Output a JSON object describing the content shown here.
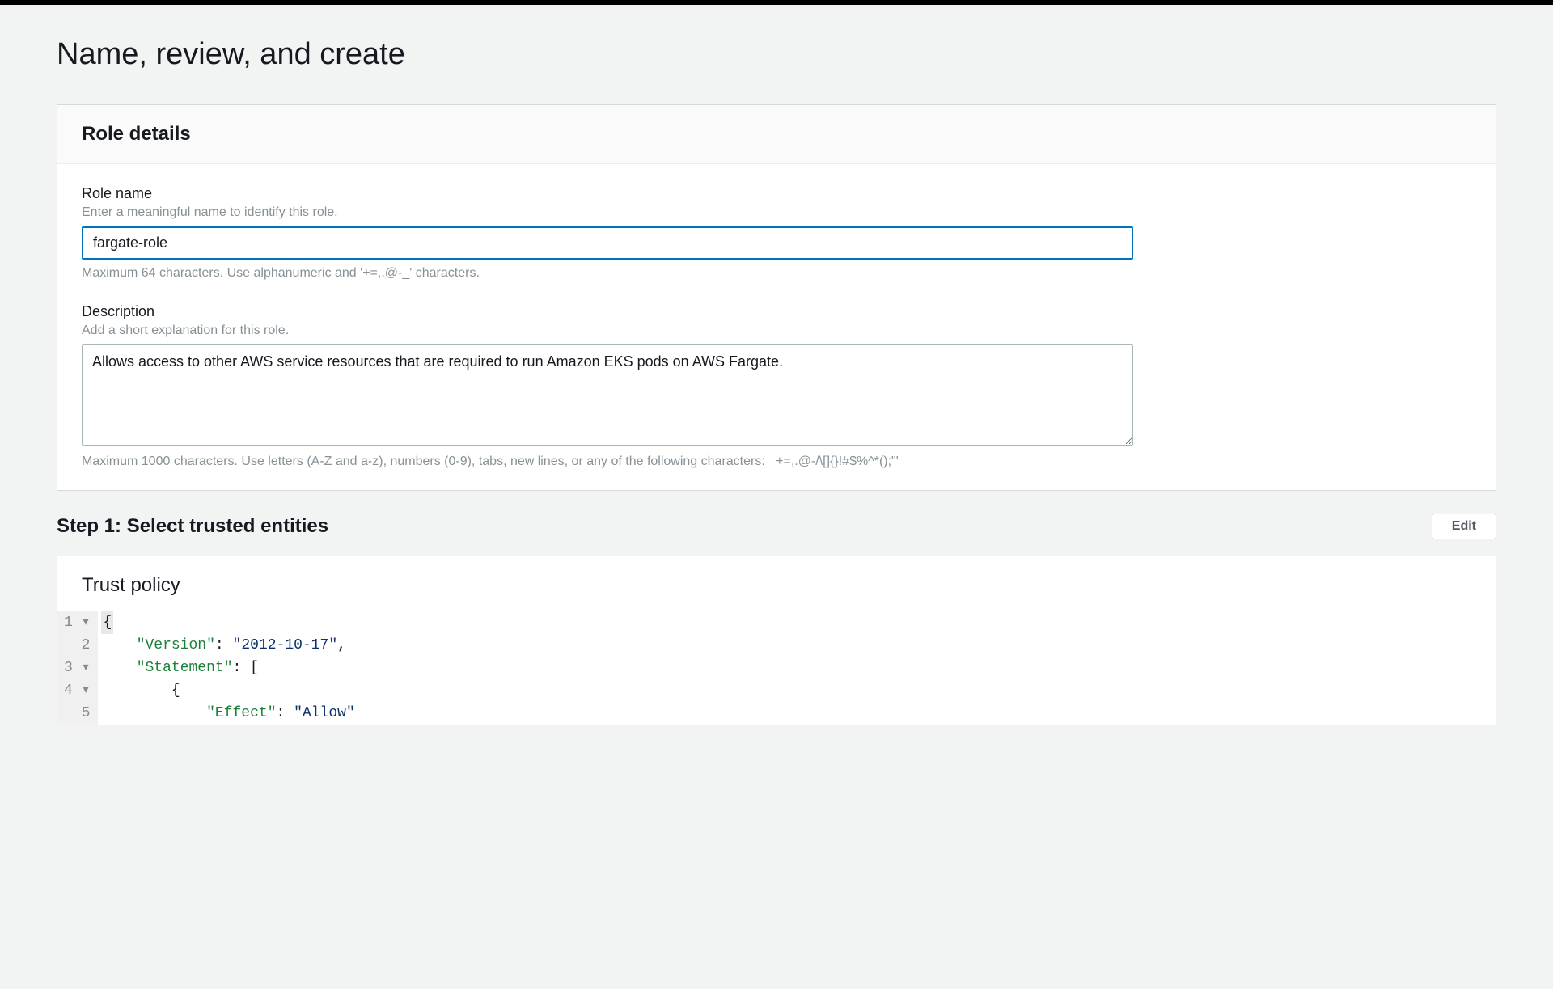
{
  "page": {
    "title": "Name, review, and create"
  },
  "roleDetails": {
    "panelTitle": "Role details",
    "roleName": {
      "label": "Role name",
      "hint": "Enter a meaningful name to identify this role.",
      "value": "fargate-role",
      "constraint": "Maximum 64 characters. Use alphanumeric and '+=,.@-_' characters."
    },
    "description": {
      "label": "Description",
      "hint": "Add a short explanation for this role.",
      "value": "Allows access to other AWS service resources that are required to run Amazon EKS pods on AWS Fargate.",
      "constraint": "Maximum 1000 characters. Use letters (A-Z and a-z), numbers (0-9), tabs, new lines, or any of the following characters: _+=,.@-/\\[]{}!#$%^*();\"'"
    }
  },
  "step1": {
    "title": "Step 1: Select trusted entities",
    "editLabel": "Edit"
  },
  "trustPolicy": {
    "title": "Trust policy",
    "code": {
      "lines": [
        {
          "num": "1",
          "marker": "▾"
        },
        {
          "num": "2",
          "marker": ""
        },
        {
          "num": "3",
          "marker": "▾"
        },
        {
          "num": "4",
          "marker": "▾"
        },
        {
          "num": "5",
          "marker": ""
        }
      ],
      "tokens": {
        "braceOpen": "{",
        "versionKey": "\"Version\"",
        "versionVal": "\"2012-10-17\"",
        "statementKey": "\"Statement\"",
        "bracketOpen": "[",
        "braceOpen2": "{",
        "effectKey": "\"Effect\"",
        "effectVal": "\"Allow\"",
        "colon": ":",
        "comma": ","
      }
    }
  }
}
